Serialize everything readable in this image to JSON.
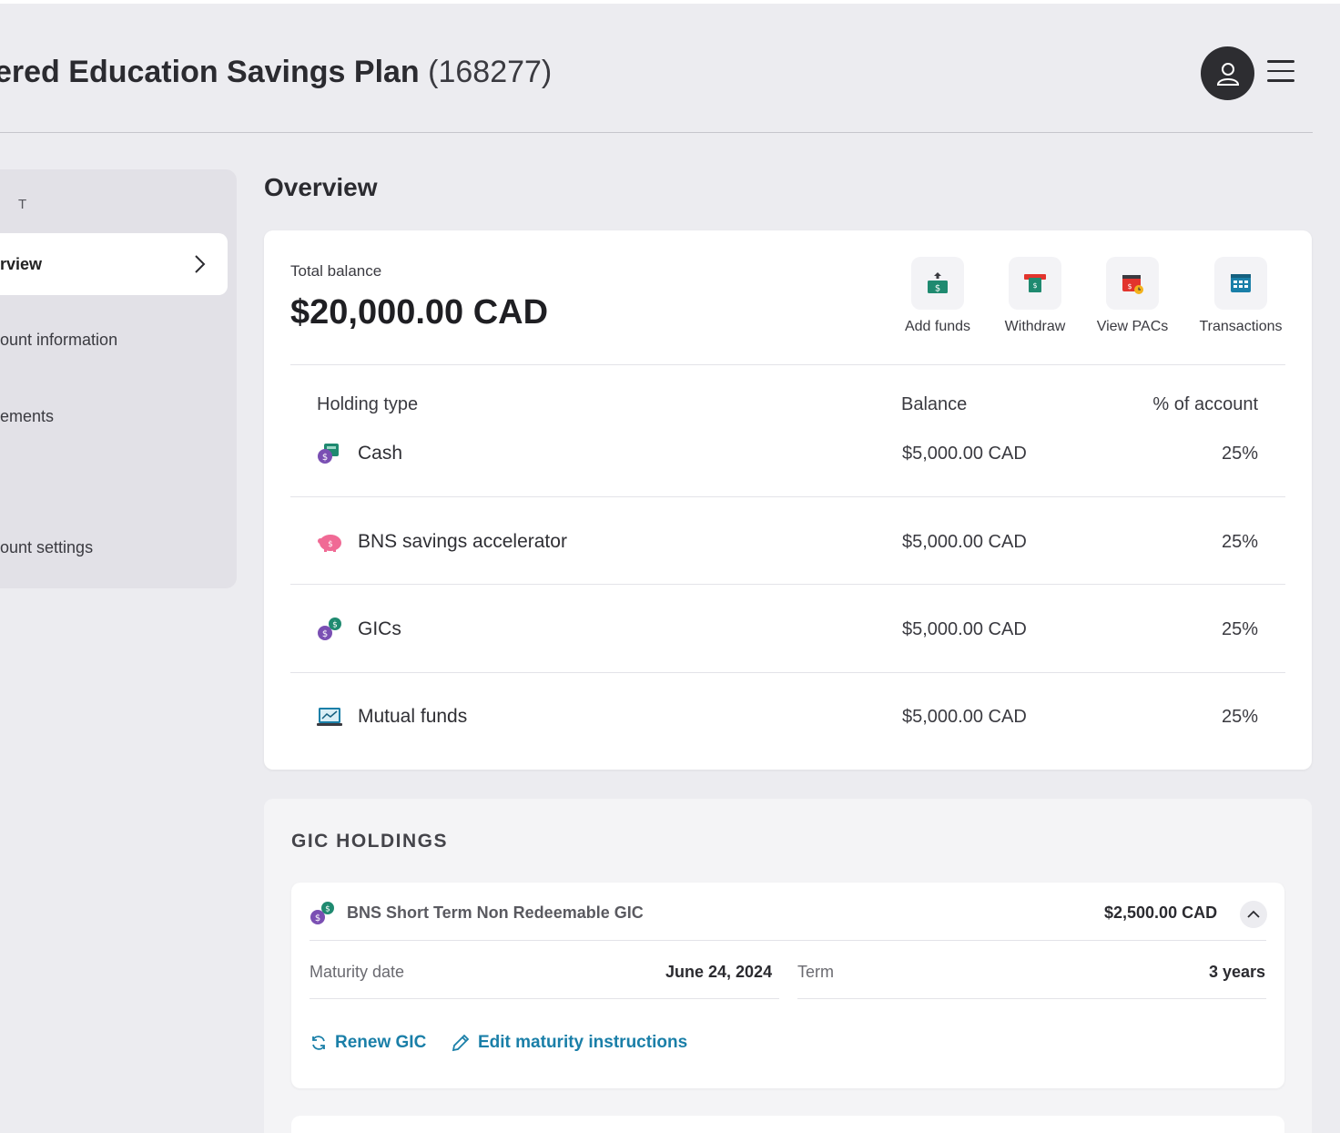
{
  "header": {
    "title_bold": "ered Education Savings Plan",
    "account_number": "(168277)"
  },
  "sidebar": {
    "section_label": "T",
    "active_item": "rview",
    "items": [
      "ount information",
      "ements",
      "ount settings"
    ]
  },
  "overview": {
    "title": "Overview",
    "total_label": "Total balance",
    "total_value": "$20,000.00 CAD",
    "actions": [
      {
        "label": "Add funds",
        "icon": "add-funds-icon"
      },
      {
        "label": "Withdraw",
        "icon": "withdraw-icon"
      },
      {
        "label": "View PACs",
        "icon": "calendar-pac-icon"
      },
      {
        "label": "Transactions",
        "icon": "transactions-calendar-icon"
      }
    ],
    "columns": [
      "Holding type",
      "Balance",
      "% of account"
    ],
    "rows": [
      {
        "label": "Cash",
        "balance": "$5,000.00 CAD",
        "pct": "25%",
        "icon": "cash-icon"
      },
      {
        "label": "BNS savings accelerator",
        "balance": "$5,000.00 CAD",
        "pct": "25%",
        "icon": "piggy-bank-icon"
      },
      {
        "label": "GICs",
        "balance": "$5,000.00 CAD",
        "pct": "25%",
        "icon": "gic-coins-icon"
      },
      {
        "label": "Mutual funds",
        "balance": "$5,000.00 CAD",
        "pct": "25%",
        "icon": "mutual-funds-icon"
      }
    ]
  },
  "gic": {
    "title": "GIC HOLDINGS",
    "item": {
      "name": "BNS Short Term Non Redeemable GIC",
      "amount": "$2,500.00 CAD",
      "maturity_label": "Maturity date",
      "maturity_value": "June 24, 2024",
      "term_label": "Term",
      "term_value": "3 years",
      "renew_label": "Renew GIC",
      "edit_label": "Edit maturity instructions"
    }
  },
  "colors": {
    "background": "#ececf0",
    "link": "#1a7fa8",
    "dark": "#2d2d31"
  }
}
